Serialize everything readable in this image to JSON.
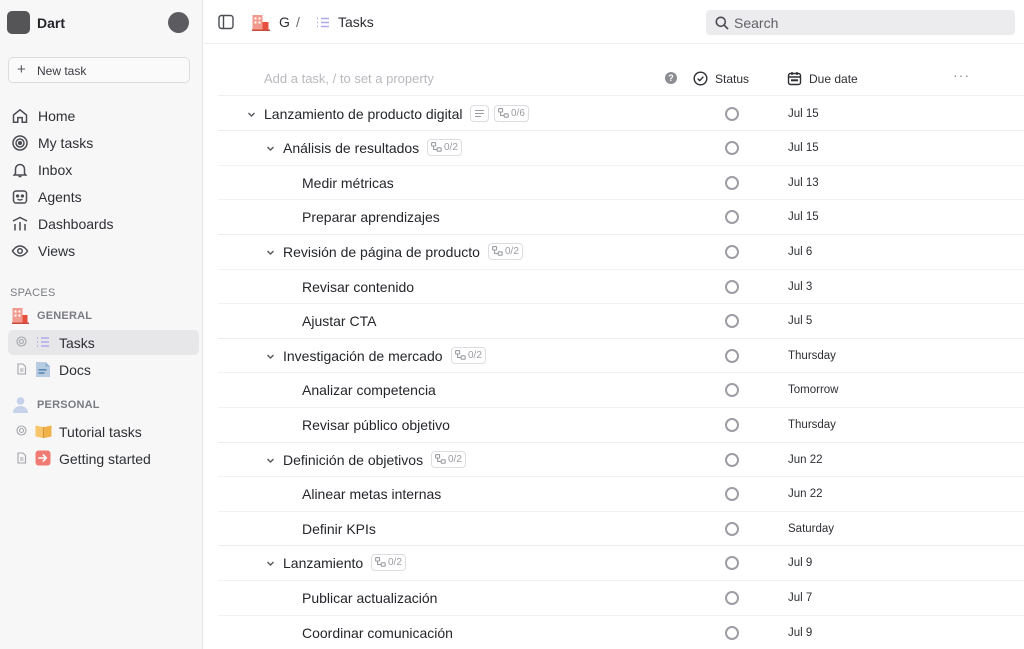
{
  "workspace": {
    "name": "Dart"
  },
  "sidebar": {
    "new_task_label": "New task",
    "nav": [
      {
        "label": "Home",
        "icon": "home-icon"
      },
      {
        "label": "My tasks",
        "icon": "target-icon"
      },
      {
        "label": "Inbox",
        "icon": "bell-icon"
      },
      {
        "label": "Agents",
        "icon": "robot-icon"
      },
      {
        "label": "Dashboards",
        "icon": "dashboard-icon"
      },
      {
        "label": "Views",
        "icon": "eye-icon"
      }
    ],
    "spaces_label": "SPACES",
    "general": {
      "label": "GENERAL",
      "items": [
        {
          "label": "Tasks",
          "icon": "list-icon",
          "active": true
        },
        {
          "label": "Docs",
          "icon": "doc-icon",
          "active": false
        }
      ]
    },
    "personal": {
      "label": "PERSONAL",
      "items": [
        {
          "label": "Tutorial tasks",
          "icon": "book-icon"
        },
        {
          "label": "Getting started",
          "icon": "arrow-right-icon"
        }
      ]
    }
  },
  "topbar": {
    "breadcrumb": {
      "space": "G",
      "separator": "/",
      "page": "Tasks"
    },
    "search_placeholder": "Search"
  },
  "table": {
    "add_task_placeholder": "Add a task, / to set a property",
    "help_glyph": "?",
    "columns": {
      "status": "Status",
      "due_date": "Due date"
    },
    "more_glyph": "···"
  },
  "rows": [
    {
      "level": 0,
      "title": "Lanzamiento de producto digital",
      "expand": true,
      "has_desc": true,
      "subtasks": "0/6",
      "due": "Jul 15"
    },
    {
      "level": 1,
      "title": "Análisis de resultados",
      "expand": true,
      "subtasks": "0/2",
      "due": "Jul 15"
    },
    {
      "level": 2,
      "title": "Medir métricas",
      "due": "Jul 13"
    },
    {
      "level": 2,
      "title": "Preparar aprendizajes",
      "due": "Jul 15"
    },
    {
      "level": 1,
      "title": "Revisión de página de producto",
      "expand": true,
      "subtasks": "0/2",
      "due": "Jul 6"
    },
    {
      "level": 2,
      "title": "Revisar contenido",
      "due": "Jul 3"
    },
    {
      "level": 2,
      "title": "Ajustar CTA",
      "due": "Jul 5"
    },
    {
      "level": 1,
      "title": "Investigación de mercado",
      "expand": true,
      "subtasks": "0/2",
      "due": "Thursday"
    },
    {
      "level": 2,
      "title": "Analizar competencia",
      "due": "Tomorrow"
    },
    {
      "level": 2,
      "title": "Revisar público objetivo",
      "due": "Thursday"
    },
    {
      "level": 1,
      "title": "Definición de objetivos",
      "expand": true,
      "subtasks": "0/2",
      "due": "Jun 22"
    },
    {
      "level": 2,
      "title": "Alinear metas internas",
      "due": "Jun 22"
    },
    {
      "level": 2,
      "title": "Definir KPIs",
      "due": "Saturday"
    },
    {
      "level": 1,
      "title": "Lanzamiento",
      "expand": true,
      "subtasks": "0/2",
      "due": "Jul 9"
    },
    {
      "level": 2,
      "title": "Publicar actualización",
      "due": "Jul 7"
    },
    {
      "level": 2,
      "title": "Coordinar comunicación",
      "due": "Jul 9"
    }
  ]
}
